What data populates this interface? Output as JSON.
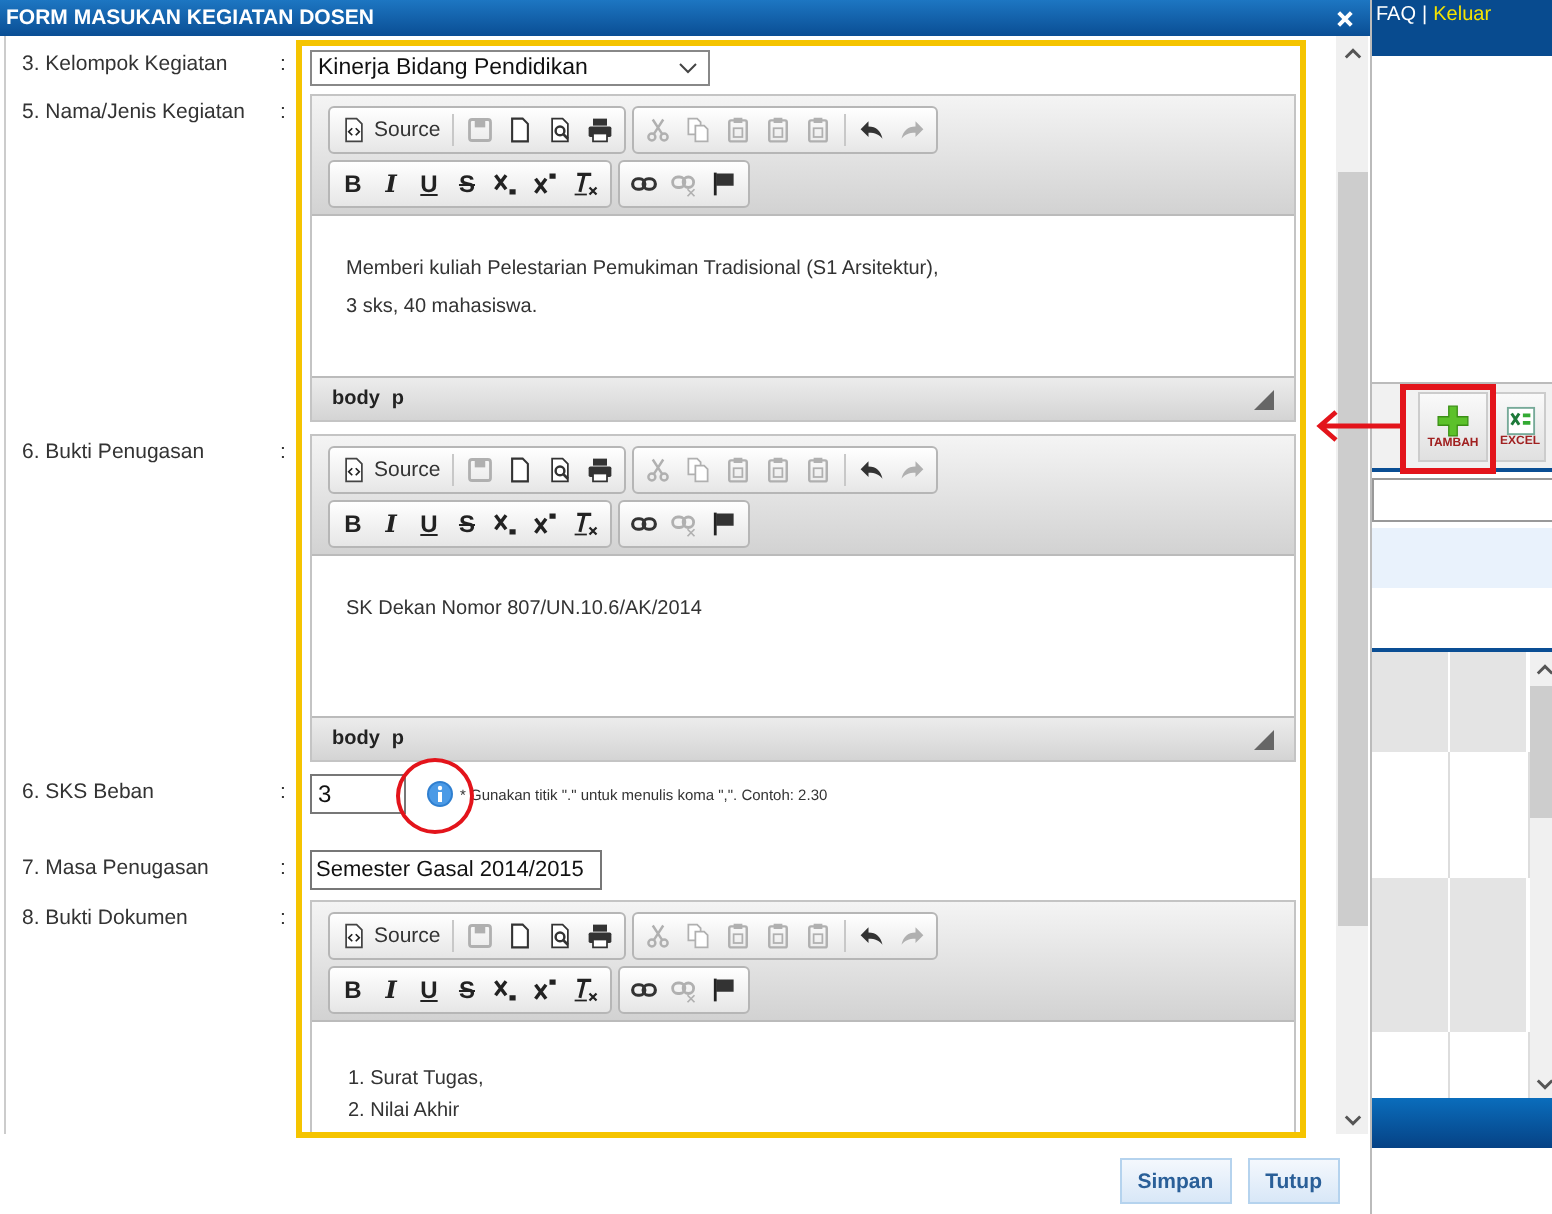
{
  "dialog": {
    "title": "FORM MASUKAN KEGIATAN DOSEN"
  },
  "fields": [
    {
      "kind": "select",
      "label": "3. Kelompok Kegiatan",
      "colon": ":",
      "value": "Kinerja Bidang Pendidikan"
    },
    {
      "kind": "editor",
      "label": "5. Nama/Jenis Kegiatan",
      "colon": ":",
      "source": "Source",
      "format": [
        "B",
        "I",
        "U",
        "S"
      ],
      "indented": false,
      "lines": [
        "Memberi kuliah Pelestarian Pemukiman Tradisional (S1 Arsitektur),",
        "3 sks, 40 mahasiswa."
      ],
      "path": [
        "body",
        "p"
      ]
    },
    {
      "kind": "editor",
      "label": "6. Bukti Penugasan",
      "colon": ":",
      "source": "Source",
      "format": [
        "B",
        "I",
        "U",
        "S"
      ],
      "indented": false,
      "lines": [
        "SK Dekan Nomor 807/UN.10.6/AK/2014"
      ],
      "path": [
        "body",
        "p"
      ]
    },
    {
      "kind": "number",
      "label": "6. SKS Beban",
      "colon": ":",
      "value": "3",
      "hint": "* Gunakan titik \".\" untuk menulis koma \",\". Contoh: 2.30"
    },
    {
      "kind": "text",
      "label": "7. Masa Penugasan",
      "colon": ":",
      "value": "Semester Gasal 2014/2015"
    },
    {
      "kind": "editor",
      "label": "8. Bukti Dokumen",
      "colon": ":",
      "source": "Source",
      "format": [
        "B",
        "I",
        "U",
        "S"
      ],
      "indented": true,
      "lines": [
        "1. Surat Tugas,",
        "2. Nilai Akhir"
      ]
    }
  ],
  "buttons": [
    "Simpan",
    "Tutup"
  ],
  "background": {
    "links": [
      "FAQ",
      "Keluar"
    ],
    "separator": "|",
    "buttons": [
      "TAMBAH",
      "EXCEL"
    ]
  }
}
